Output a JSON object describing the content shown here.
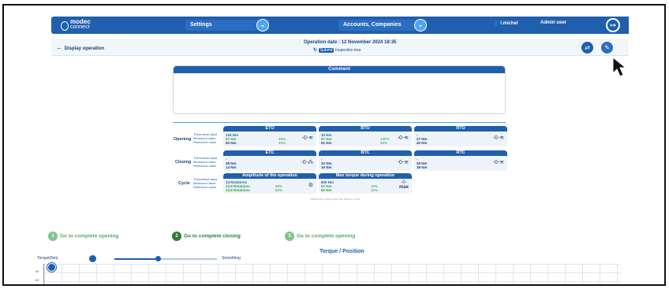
{
  "topbar": {
    "logo_main": "modec",
    "logo_sub": "connect",
    "select1": "Settings",
    "select2": "Accounts, Companies",
    "user_name": "l.michel",
    "user_role": "Admin user",
    "logout_icon": "logout-icon"
  },
  "subbar": {
    "back_label": "Display operation",
    "operation_date": "Operation date : 12 November 2024 18:35",
    "status_badge": "Submit",
    "status_text": "Inspection tour"
  },
  "comment": {
    "title": "Comment"
  },
  "rows": {
    "opening": "Opening",
    "closing": "Closing",
    "cycle": "Cycle"
  },
  "labels": {
    "theoretical": "Theoretical value",
    "measured": "Measured value",
    "reference": "Reference value"
  },
  "cards": {
    "eto": {
      "title": "ETO",
      "v1": "125 Nm",
      "v2": "57 Nm",
      "v3": "50 Nm",
      "p1": "46%",
      "p2": "46%"
    },
    "bto": {
      "title": "BTO",
      "v1": "33 Nm",
      "v2": "57 Nm",
      "v3": "61 Nm",
      "p1": "100%",
      "p2": "93%"
    },
    "rto": {
      "title": "RTO",
      "v1": "-",
      "v2": "27 Nm",
      "v3": "40 Nm"
    },
    "etc": {
      "title": "ETC",
      "v1": "-",
      "v2": "38 Nm",
      "v3": "14 Nm"
    },
    "btc": {
      "title": "BTC",
      "v1": "-",
      "v2": "32 Nm",
      "v3": "16 Nm"
    },
    "rtc": {
      "title": "RTC",
      "v1": "-",
      "v2": "29 Nm",
      "v3": "39 Nm"
    },
    "amp": {
      "title": "Amplitude of the operation",
      "v1": "14 Rotations",
      "v2": "13.8 Rotations",
      "v3": "13.8 Rotations",
      "p1": "99%",
      "p2": "55%"
    },
    "max": {
      "title": "Max torque during operation",
      "v1": "800 Nm",
      "v2": "57 Nm",
      "v3": "50 Nm",
      "p1": "10%",
      "p2": "10%",
      "icon_text": "max"
    }
  },
  "footnote": "Values and value icons are shown in Nm.",
  "steps": [
    {
      "num": "1",
      "label": "Go to complete opening",
      "color": "#7fc48a"
    },
    {
      "num": "2",
      "label": "Go to complete closing",
      "color": "#2e7d32"
    },
    {
      "num": "3",
      "label": "Go to complete opening",
      "color": "#7fc48a"
    }
  ],
  "chart": {
    "title": "Torque / Position",
    "ylabel": "Torque(Nm)",
    "smoothing": "Smoothing",
    "yticks": [
      "90",
      "60"
    ]
  }
}
